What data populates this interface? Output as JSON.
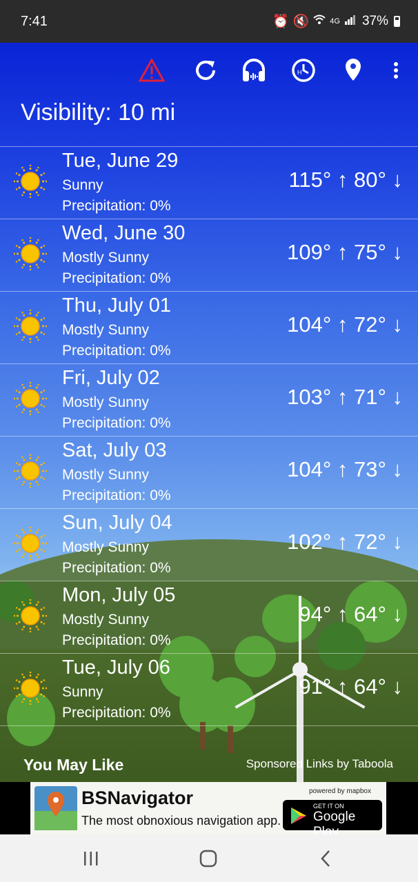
{
  "status_bar": {
    "time": "7:41",
    "battery": "37%",
    "network": "4G"
  },
  "toolbar": {
    "icons": [
      "alert-icon",
      "refresh-icon",
      "headphones-icon",
      "history-icon",
      "location-icon",
      "more-vert-icon"
    ],
    "alert_color": "#e0203a"
  },
  "visibility": "Visibility: 10 mi",
  "forecast": [
    {
      "day": "Tue, June 29",
      "condition": "Sunny",
      "precipitation": "Precipitation: 0%",
      "temps": "115° ↑  80° ↓"
    },
    {
      "day": "Wed, June 30",
      "condition": "Mostly Sunny",
      "precipitation": "Precipitation: 0%",
      "temps": "109° ↑  75° ↓"
    },
    {
      "day": "Thu, July 01",
      "condition": "Mostly Sunny",
      "precipitation": "Precipitation: 0%",
      "temps": "104° ↑  72° ↓"
    },
    {
      "day": "Fri, July 02",
      "condition": "Mostly Sunny",
      "precipitation": "Precipitation: 0%",
      "temps": "103° ↑  71° ↓"
    },
    {
      "day": "Sat, July 03",
      "condition": "Mostly Sunny",
      "precipitation": "Precipitation: 0%",
      "temps": "104° ↑  73° ↓"
    },
    {
      "day": "Sun, July 04",
      "condition": "Mostly Sunny",
      "precipitation": "Precipitation: 0%",
      "temps": "102° ↑  72° ↓"
    },
    {
      "day": "Mon, July 05",
      "condition": "Mostly Sunny",
      "precipitation": "Precipitation: 0%",
      "temps": "94° ↑  64° ↓"
    },
    {
      "day": "Tue, July 06",
      "condition": "Sunny",
      "precipitation": "Precipitation: 0%",
      "temps": "91° ↑  64° ↓"
    }
  ],
  "recommendations": {
    "title": "You May Like",
    "sponsor": "Sponsored Links by Taboola"
  },
  "ad": {
    "title": "BSNavigator",
    "subtitle": "The most obnoxious navigation app.",
    "powered_by": "powered by mapbox",
    "store_small": "GET IT ON",
    "store_big": "Google Play"
  },
  "colors": {
    "sky_top": "#0a24d6",
    "sun": "#f5b800"
  }
}
